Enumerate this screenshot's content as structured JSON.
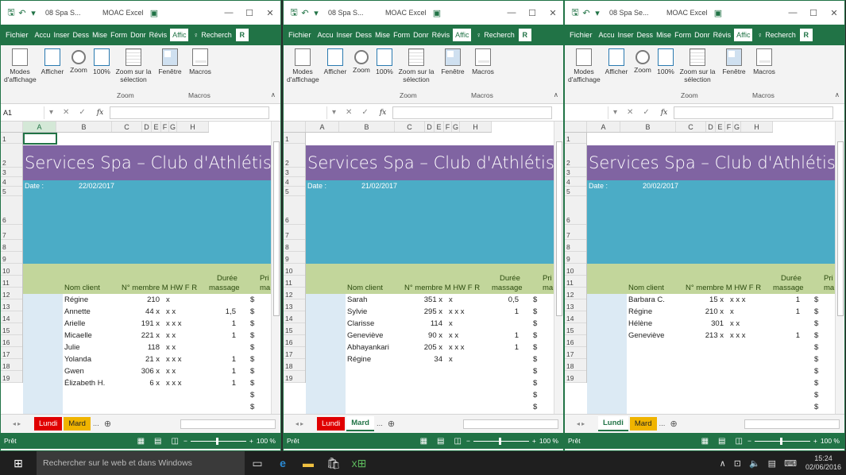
{
  "windows": [
    {
      "title": {
        "file": "08 Spa S...",
        "app": "MOAC Excel"
      },
      "namebox": "A1",
      "ribbon_tabs": [
        "Fichier",
        "Accu",
        "Inser",
        "Dess",
        "Mise",
        "Form",
        "Donr",
        "Révis",
        "Affic"
      ],
      "search_label": "Recherch",
      "ribbon_buttons": [
        "Modes d'affichage",
        "Afficher",
        "Zoom",
        "100%",
        "Zoom sur la sélection",
        "Fenêtre",
        "Macros"
      ],
      "groups": [
        "Zoom",
        "Macros"
      ],
      "columns": [
        "A",
        "B",
        "C",
        "D",
        "E",
        "F",
        "G",
        "H"
      ],
      "rows": [
        "1",
        "2",
        "3",
        "4",
        "5",
        "6",
        "7",
        "8",
        "9",
        "10",
        "11",
        "12",
        "13",
        "14",
        "15",
        "16",
        "17",
        "18",
        "19"
      ],
      "title_text": "Services Spa – Club d'Athlétism",
      "date_label": "Date :",
      "date_value": "22/02/2017",
      "headers": {
        "nom": "Nom client",
        "membre": "N° membre M HW F R",
        "duree1": "Durée",
        "duree2": "massage",
        "prix1": "Pri",
        "prix2": "ma"
      },
      "clients": [
        {
          "name": "Régine",
          "num": "210",
          "marks": "x",
          "dur": "",
          "price": "$"
        },
        {
          "name": "Annette",
          "num": "44 x",
          "marks": "x x",
          "dur": "1,5",
          "price": "$"
        },
        {
          "name": "Arielle",
          "num": "191 x",
          "marks": "x x x",
          "dur": "1",
          "price": "$"
        },
        {
          "name": "Micaelle",
          "num": "221 x",
          "marks": "x x",
          "dur": "1",
          "price": "$"
        },
        {
          "name": "Julie",
          "num": "118",
          "marks": "x x",
          "dur": "",
          "price": "$"
        },
        {
          "name": "Yolanda",
          "num": "21 x",
          "marks": "x x x",
          "dur": "1",
          "price": "$"
        },
        {
          "name": "Gwen",
          "num": "306 x",
          "marks": "x x",
          "dur": "1",
          "price": "$"
        },
        {
          "name": "Élizabeth H.",
          "num": "6 x",
          "marks": "x x x",
          "dur": "1",
          "price": "$"
        }
      ],
      "extra_dollars": [
        "$",
        "$",
        "$",
        "$"
      ],
      "sheet_tabs": [
        "Lundi",
        "Mard",
        "..."
      ],
      "status": "Prêt",
      "zoom": "100 %"
    },
    {
      "title": {
        "file": "08 Spa S...",
        "app": "MOAC Excel"
      },
      "namebox": "",
      "ribbon_tabs": [
        "Fichier",
        "Accu",
        "Inser",
        "Dess",
        "Mise",
        "Form",
        "Donr",
        "Révis",
        "Affic"
      ],
      "search_label": "Recherch",
      "ribbon_buttons": [
        "Modes d'affichage",
        "Afficher",
        "Zoom",
        "100%",
        "Zoom sur la sélection",
        "Fenêtre",
        "Macros"
      ],
      "groups": [
        "Zoom",
        "Macros"
      ],
      "columns": [
        "A",
        "B",
        "C",
        "D",
        "E",
        "F",
        "G",
        "H"
      ],
      "rows": [
        "1",
        "2",
        "3",
        "4",
        "5",
        "6",
        "7",
        "8",
        "9",
        "10",
        "11",
        "12",
        "13",
        "14",
        "15",
        "16",
        "17",
        "18",
        "19"
      ],
      "title_text": "Services Spa – Club d'Athlétism",
      "date_label": "Date :",
      "date_value": "21/02/2017",
      "headers": {
        "nom": "Nom client",
        "membre": "N° membre M HW F R",
        "duree1": "Durée",
        "duree2": "massage",
        "prix1": "Pri",
        "prix2": "ma"
      },
      "clients": [
        {
          "name": "Sarah",
          "num": "351 x",
          "marks": "x",
          "dur": "0,5",
          "price": "$"
        },
        {
          "name": "Sylvie",
          "num": "295 x",
          "marks": "x x x",
          "dur": "1",
          "price": "$"
        },
        {
          "name": "Clarisse",
          "num": "114",
          "marks": "x",
          "dur": "",
          "price": "$"
        },
        {
          "name": "Geneviève",
          "num": "90 x",
          "marks": "x x",
          "dur": "1",
          "price": "$"
        },
        {
          "name": "Abhayankari",
          "num": "205 x",
          "marks": "x x x",
          "dur": "1",
          "price": "$"
        },
        {
          "name": "Régine",
          "num": "34",
          "marks": "x",
          "dur": "",
          "price": "$"
        }
      ],
      "extra_dollars": [
        "$",
        "$",
        "$",
        "$",
        "$",
        "$"
      ],
      "sheet_tabs": [
        "Lundi",
        "Mard",
        "..."
      ],
      "status": "Prêt",
      "zoom": "100 %"
    },
    {
      "title": {
        "file": "08 Spa Se...",
        "app": "MOAC Excel"
      },
      "namebox": "",
      "ribbon_tabs": [
        "Fichier",
        "Accu",
        "Inser",
        "Dess",
        "Mise",
        "Form",
        "Donr",
        "Révis",
        "Affic"
      ],
      "search_label": "Recherch",
      "ribbon_buttons": [
        "Modes d'affichage",
        "Afficher",
        "Zoom",
        "100%",
        "Zoom sur la sélection",
        "Fenêtre",
        "Macros"
      ],
      "groups": [
        "Zoom",
        "Macros"
      ],
      "columns": [
        "A",
        "B",
        "C",
        "D",
        "E",
        "F",
        "G",
        "H"
      ],
      "rows": [
        "1",
        "2",
        "3",
        "4",
        "5",
        "6",
        "7",
        "8",
        "9",
        "10",
        "11",
        "12",
        "13",
        "14",
        "15",
        "16",
        "17",
        "18",
        "19"
      ],
      "title_text": "Services Spa – Club d'Athlétism",
      "date_label": "Date :",
      "date_value": "20/02/2017",
      "headers": {
        "nom": "Nom client",
        "membre": "N° membre M HW F R",
        "duree1": "Durée",
        "duree2": "massage",
        "prix1": "Pri",
        "prix2": "ma"
      },
      "clients": [
        {
          "name": "Barbara C.",
          "num": "15 x",
          "marks": "x x x",
          "dur": "1",
          "price": "$"
        },
        {
          "name": "Régine",
          "num": "210 x",
          "marks": "x",
          "dur": "1",
          "price": "$"
        },
        {
          "name": "Hélène",
          "num": "301",
          "marks": "x x",
          "dur": "",
          "price": "$"
        },
        {
          "name": "Geneviève",
          "num": "213 x",
          "marks": "x x x",
          "dur": "1",
          "price": "$"
        }
      ],
      "extra_dollars": [
        "$",
        "$",
        "$",
        "$",
        "$",
        "$",
        "$",
        "$"
      ],
      "sheet_tabs": [
        "Lundi",
        "Mard",
        "..."
      ],
      "status": "Prêt",
      "zoom": "100 %"
    }
  ],
  "taskbar": {
    "search_placeholder": "Rechercher sur le web et dans Windows",
    "time": "15:24",
    "date": "02/06/2016"
  }
}
